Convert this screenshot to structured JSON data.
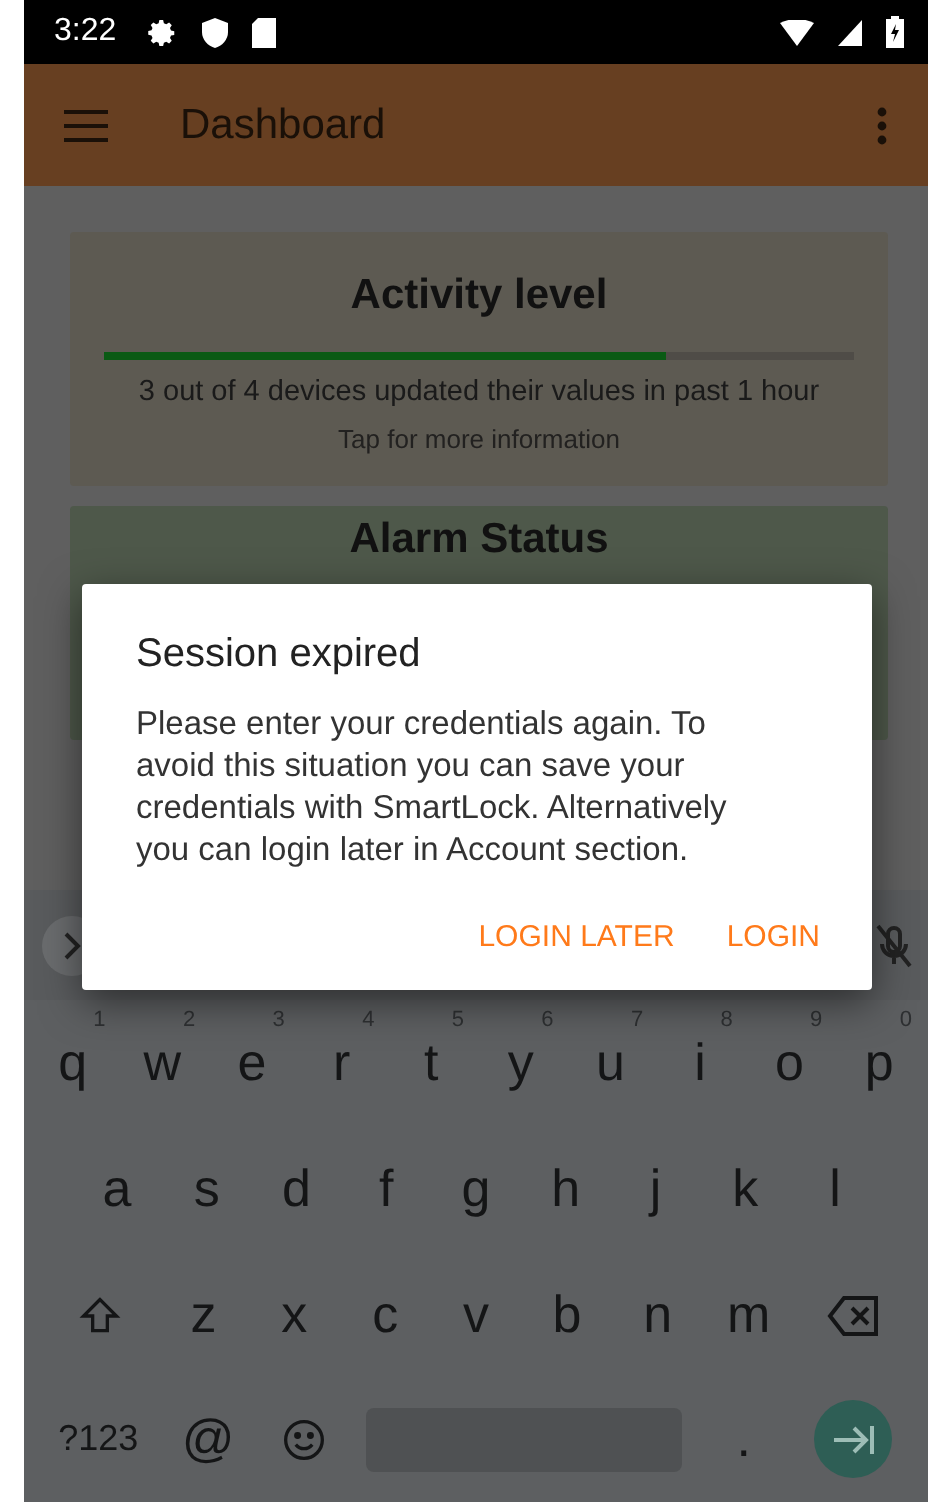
{
  "status_bar": {
    "time": "3:22"
  },
  "app_bar": {
    "title": "Dashboard"
  },
  "cards": [
    {
      "kind": "activity",
      "title": "Activity level",
      "level": 0.75,
      "summary": "3 out of 4 devices updated their values in past 1 hour",
      "hint": "Tap for more information"
    },
    {
      "kind": "status",
      "title": "Alarm Status"
    }
  ],
  "dialog": {
    "title": "Session expired",
    "message": "Please enter your credentials again. To avoid this situation you can save your credentials with SmartLock. Alternatively you can login later in Account section.",
    "buttons": [
      "LOGIN LATER",
      "LOGIN"
    ]
  },
  "keyboard": {
    "rows": [
      {
        "keys": [
          {
            "key": "q",
            "hint": "1"
          },
          {
            "key": "w",
            "hint": "2"
          },
          {
            "key": "e",
            "hint": "3"
          },
          {
            "key": "r",
            "hint": "4"
          },
          {
            "key": "t",
            "hint": "5"
          },
          {
            "key": "y",
            "hint": "6"
          },
          {
            "key": "u",
            "hint": "7"
          },
          {
            "key": "i",
            "hint": "8"
          },
          {
            "key": "o",
            "hint": "9"
          },
          {
            "key": "p",
            "hint": "0"
          }
        ]
      },
      {
        "keys": [
          {
            "key": "a"
          },
          {
            "key": "s"
          },
          {
            "key": "d"
          },
          {
            "key": "f"
          },
          {
            "key": "g"
          },
          {
            "key": "h"
          },
          {
            "key": "j"
          },
          {
            "key": "k"
          },
          {
            "key": "l"
          }
        ]
      },
      {
        "keys": [
          {
            "kind": "shift"
          },
          {
            "key": "z"
          },
          {
            "key": "x"
          },
          {
            "key": "c"
          },
          {
            "key": "v"
          },
          {
            "key": "b"
          },
          {
            "key": "n"
          },
          {
            "key": "m"
          },
          {
            "kind": "backspace"
          }
        ]
      },
      {
        "keys": [
          {
            "kind": "symbols",
            "key": "?123"
          },
          {
            "key": "@"
          },
          {
            "kind": "emoji"
          },
          {
            "kind": "space"
          },
          {
            "key": "."
          },
          {
            "kind": "enter"
          }
        ]
      }
    ]
  }
}
